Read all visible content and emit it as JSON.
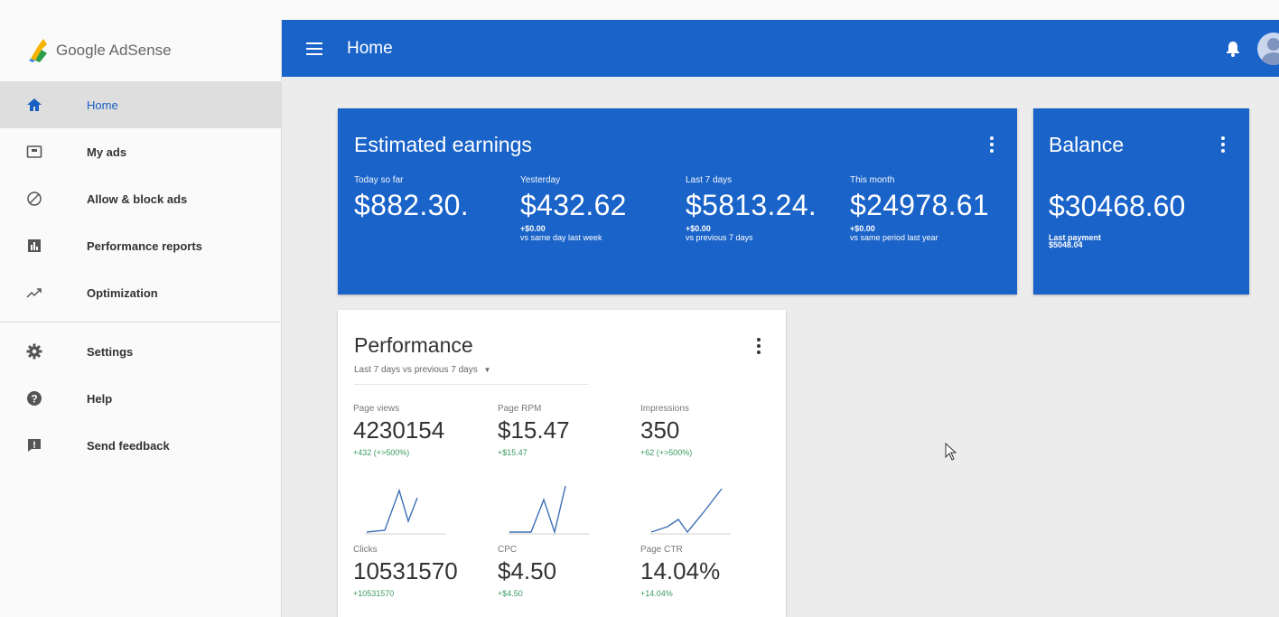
{
  "app": {
    "logo_text": "Google AdSense",
    "page_title": "Home"
  },
  "sidebar": {
    "items": [
      {
        "label": "Home",
        "icon": "home-icon",
        "active": true
      },
      {
        "label": "My ads",
        "icon": "ad-unit-icon"
      },
      {
        "label": "Allow & block ads",
        "icon": "block-icon"
      },
      {
        "label": "Performance reports",
        "icon": "bar-chart-icon"
      },
      {
        "label": "Optimization",
        "icon": "trending-up-icon"
      }
    ],
    "secondary_items": [
      {
        "label": "Settings",
        "icon": "gear-icon"
      },
      {
        "label": "Help",
        "icon": "help-icon"
      },
      {
        "label": "Send feedback",
        "icon": "feedback-icon"
      }
    ]
  },
  "earnings": {
    "title": "Estimated earnings",
    "columns": [
      {
        "label": "Today so far",
        "value": "$882.30.",
        "change": "",
        "comparison": ""
      },
      {
        "label": "Yesterday",
        "value": "$432.62",
        "change": "+$0.00",
        "comparison": "vs same day last week"
      },
      {
        "label": "Last 7 days",
        "value": "$5813.24.",
        "change": "+$0.00",
        "comparison": "vs previous 7 days"
      },
      {
        "label": "This month",
        "value": "$24978.61",
        "change": "+$0.00",
        "comparison": "vs same period last year"
      }
    ]
  },
  "balance": {
    "title": "Balance",
    "value": "$30468.60",
    "last_payment_label": "Last payment",
    "last_payment_value": "$5048.04"
  },
  "performance": {
    "title": "Performance",
    "range": "Last 7 days vs previous 7 days",
    "metrics": [
      {
        "label": "Page views",
        "value": "4230154",
        "change": "+432 (+>500%)"
      },
      {
        "label": "Page RPM",
        "value": "$15.47",
        "change": "+$15.47"
      },
      {
        "label": "Impressions",
        "value": "350",
        "change": "+62 (+>500%)"
      },
      {
        "label": "Clicks",
        "value": "10531570",
        "change": "+10531570"
      },
      {
        "label": "CPC",
        "value": "$4.50",
        "change": "+$4.50"
      },
      {
        "label": "Page CTR",
        "value": "14.04%",
        "change": "+14.04%"
      }
    ]
  },
  "colors": {
    "brand_blue": "#1a63c9",
    "positive_green": "#3b9a5f",
    "sparkline": "#3d6fb6"
  }
}
